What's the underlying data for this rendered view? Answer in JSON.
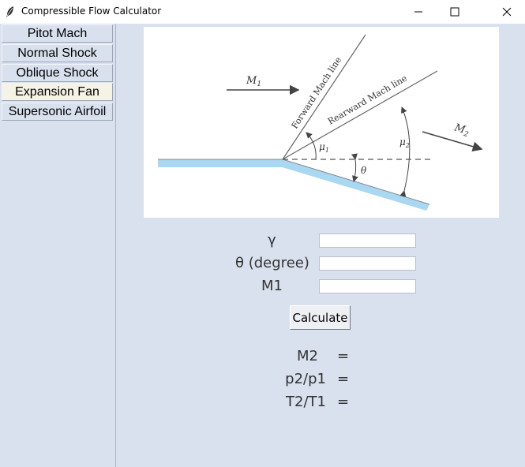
{
  "window": {
    "title": "Compressible Flow Calculator"
  },
  "sidebar": {
    "items": [
      {
        "label": "Pitot Mach",
        "active": false
      },
      {
        "label": "Normal Shock",
        "active": false
      },
      {
        "label": "Oblique Shock",
        "active": false
      },
      {
        "label": "Expansion Fan",
        "active": true
      },
      {
        "label": "Supersonic Airfoil",
        "active": false
      }
    ]
  },
  "figure": {
    "labels": {
      "m1": "M",
      "m1_sub": "1",
      "m2": "M",
      "m2_sub": "2",
      "forward": "Forward Mach line",
      "rearward": "Rearward Mach line",
      "mu1": "μ",
      "mu1_sub": "1",
      "mu2": "μ",
      "mu2_sub": "2",
      "theta": "θ"
    },
    "colors": {
      "wall": "#a9d8f2",
      "line": "#555555"
    }
  },
  "form": {
    "gamma_label": "γ",
    "theta_label": "θ (degree)",
    "m1_label": "M1",
    "gamma_value": "",
    "theta_value": "",
    "m1_value": "",
    "calculate_label": "Calculate"
  },
  "outputs": [
    {
      "label": "M2",
      "eq": "=",
      "value": ""
    },
    {
      "label": "p2/p1",
      "eq": "=",
      "value": ""
    },
    {
      "label": "T2/T1",
      "eq": "=",
      "value": ""
    }
  ]
}
